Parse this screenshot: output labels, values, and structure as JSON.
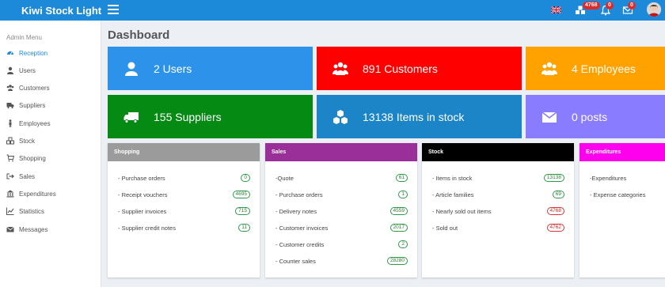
{
  "app": {
    "title": "Kiwi Stock Light"
  },
  "topbar": {
    "notifications": [
      {
        "icon": "cubes-icon",
        "count": "4768"
      },
      {
        "icon": "bell-icon",
        "count": "0"
      },
      {
        "icon": "envelope-icon",
        "count": "0"
      }
    ]
  },
  "sidebar": {
    "header": "Admin Menu",
    "items": [
      {
        "label": "Reception",
        "icon": "dashboard-icon",
        "active": true
      },
      {
        "label": "Users",
        "icon": "user-icon"
      },
      {
        "label": "Customers",
        "icon": "users-icon"
      },
      {
        "label": "Suppliers",
        "icon": "truck-icon"
      },
      {
        "label": "Employees",
        "icon": "male-icon"
      },
      {
        "label": "Stock",
        "icon": "cubes-icon"
      },
      {
        "label": "Shopping",
        "icon": "cart-icon"
      },
      {
        "label": "Sales",
        "icon": "sign-out-icon"
      },
      {
        "label": "Expenditures",
        "icon": "bank-icon"
      },
      {
        "label": "Statistics",
        "icon": "line-chart-icon"
      },
      {
        "label": "Messages",
        "icon": "envelope-icon"
      }
    ]
  },
  "main": {
    "title": "Dashboard",
    "stats": [
      {
        "label": "2 Users",
        "color": "#2d93ea",
        "icon": "user-icon"
      },
      {
        "label": "891 Customers",
        "color": "#ff0000",
        "icon": "users-icon"
      },
      {
        "label": "4 Employees",
        "color": "#ffa200",
        "icon": "users-icon"
      },
      {
        "label": "155 Suppliers",
        "color": "#058a14",
        "icon": "truck-icon"
      },
      {
        "label": "13138 Items in stock",
        "color": "#1b85c8",
        "icon": "cubes-icon"
      },
      {
        "label": "0 posts",
        "color": "#8a7cff",
        "icon": "envelope-icon"
      }
    ],
    "panels": [
      {
        "title": "Shopping",
        "color": "#9b9b9b",
        "rows": [
          {
            "label": "- Purchase orders",
            "count": "0",
            "status": "green"
          },
          {
            "label": "- Receipt vouchers",
            "count": "4695",
            "status": "green"
          },
          {
            "label": "- Supplier invoices",
            "count": "715",
            "status": "green"
          },
          {
            "label": "- Supplier credit notes",
            "count": "11",
            "status": "green"
          }
        ]
      },
      {
        "title": "Sales",
        "color": "#9a2f9a",
        "rows": [
          {
            "label": "-Quote",
            "count": "61",
            "status": "green"
          },
          {
            "label": "- Purchase orders",
            "count": "1",
            "status": "green"
          },
          {
            "label": "- Delivery notes",
            "count": "4559",
            "status": "green"
          },
          {
            "label": "- Customer invoices",
            "count": "2017",
            "status": "green"
          },
          {
            "label": "- Customer credits",
            "count": "2",
            "status": "green"
          },
          {
            "label": "- Counter sales",
            "count": "28280",
            "status": "green"
          }
        ]
      },
      {
        "title": "Stock",
        "color": "#000000",
        "rows": [
          {
            "label": "- Items in stock",
            "count": "13138",
            "status": "green"
          },
          {
            "label": "- Article families",
            "count": "69",
            "status": "green"
          },
          {
            "label": "- Nearly sold out items",
            "count": "4768",
            "status": "red"
          },
          {
            "label": "- Sold out",
            "count": "4762",
            "status": "red"
          }
        ]
      },
      {
        "title": "Expenditures",
        "color": "#ff00ee",
        "rows": [
          {
            "label": "-Expenditures",
            "count": "",
            "status": ""
          },
          {
            "label": "- Expense categories",
            "count": "",
            "status": ""
          }
        ]
      }
    ]
  }
}
